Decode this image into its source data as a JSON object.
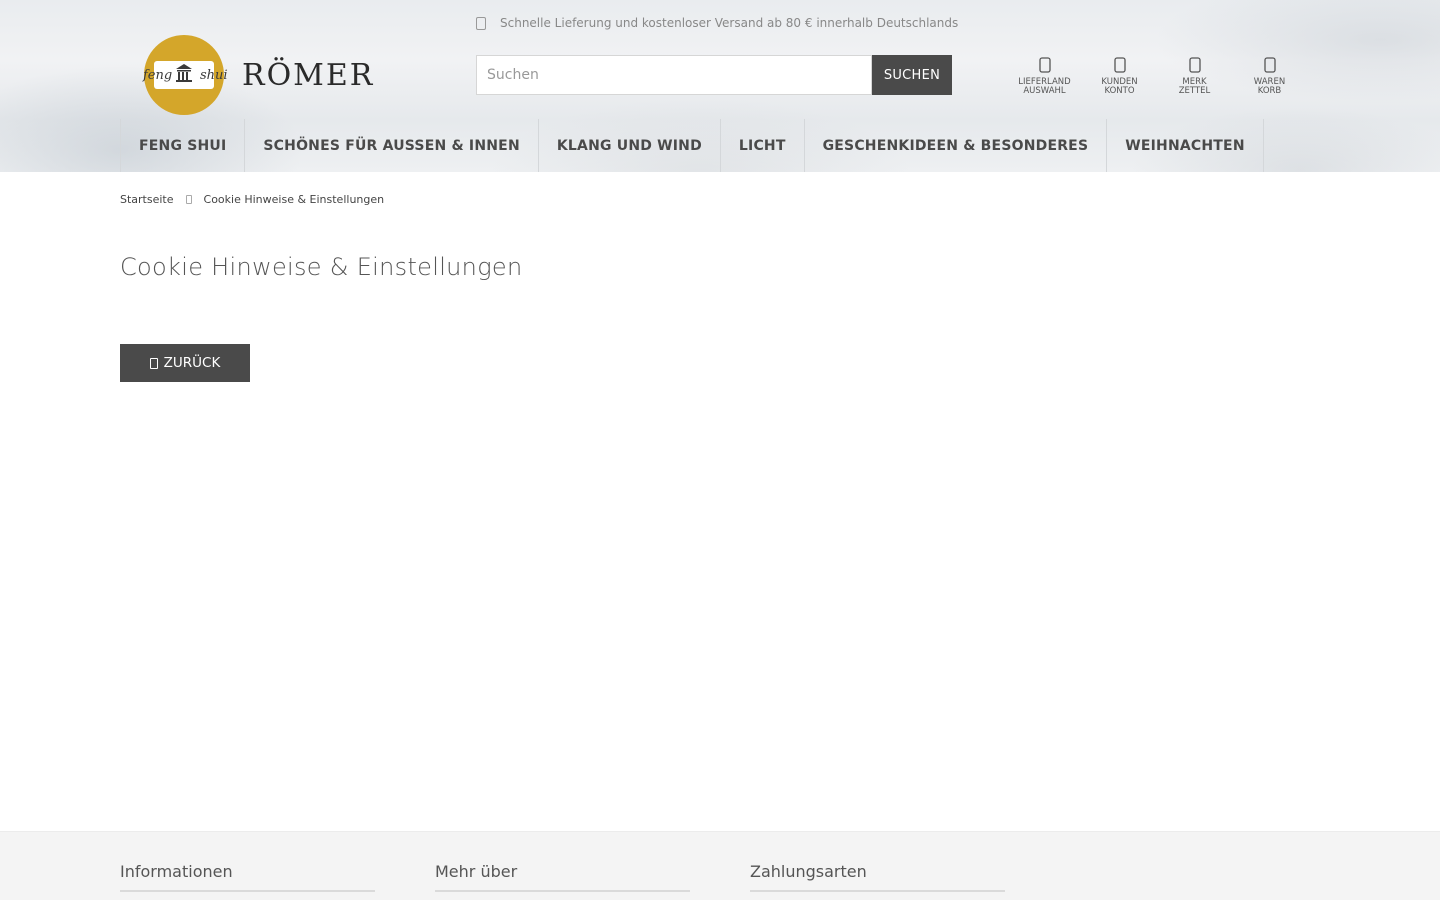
{
  "promo": {
    "text": "Schnelle Lieferung und kostenloser Versand ab 80 € innerhalb Deutschlands",
    "icon": "truck-icon"
  },
  "logo": {
    "left_text": "feng",
    "right_text": "shui",
    "brand": "RÖMER",
    "ring_color": "#d4a62a"
  },
  "search": {
    "placeholder": "Suchen",
    "value": "",
    "button_label": "SUCHEN"
  },
  "header_actions": [
    {
      "line1": "LIEFERLAND",
      "line2": "AUSWAHL",
      "icon": "globe-icon"
    },
    {
      "line1": "KUNDEN",
      "line2": "KONTO",
      "icon": "user-icon"
    },
    {
      "line1": "MERK",
      "line2": "ZETTEL",
      "icon": "heart-icon"
    },
    {
      "line1": "WAREN",
      "line2": "KORB",
      "icon": "cart-icon"
    }
  ],
  "nav": [
    "FENG SHUI",
    "SCHÖNES FÜR AUSSEN & INNEN",
    "KLANG UND WIND",
    "LICHT",
    "GESCHENKIDEEN & BESONDERES",
    "WEIHNACHTEN"
  ],
  "breadcrumb": {
    "home": "Startseite",
    "current": "Cookie Hinweise & Einstellungen"
  },
  "main": {
    "title": "Cookie Hinweise & Einstellungen",
    "back_label": "ZURÜCK"
  },
  "footer": {
    "columns": [
      "Informationen",
      "Mehr über",
      "Zahlungsarten"
    ]
  },
  "colors": {
    "button_bg": "#4a4a4a",
    "logo_gold": "#d4a62a",
    "footer_bg": "#f4f4f4"
  }
}
